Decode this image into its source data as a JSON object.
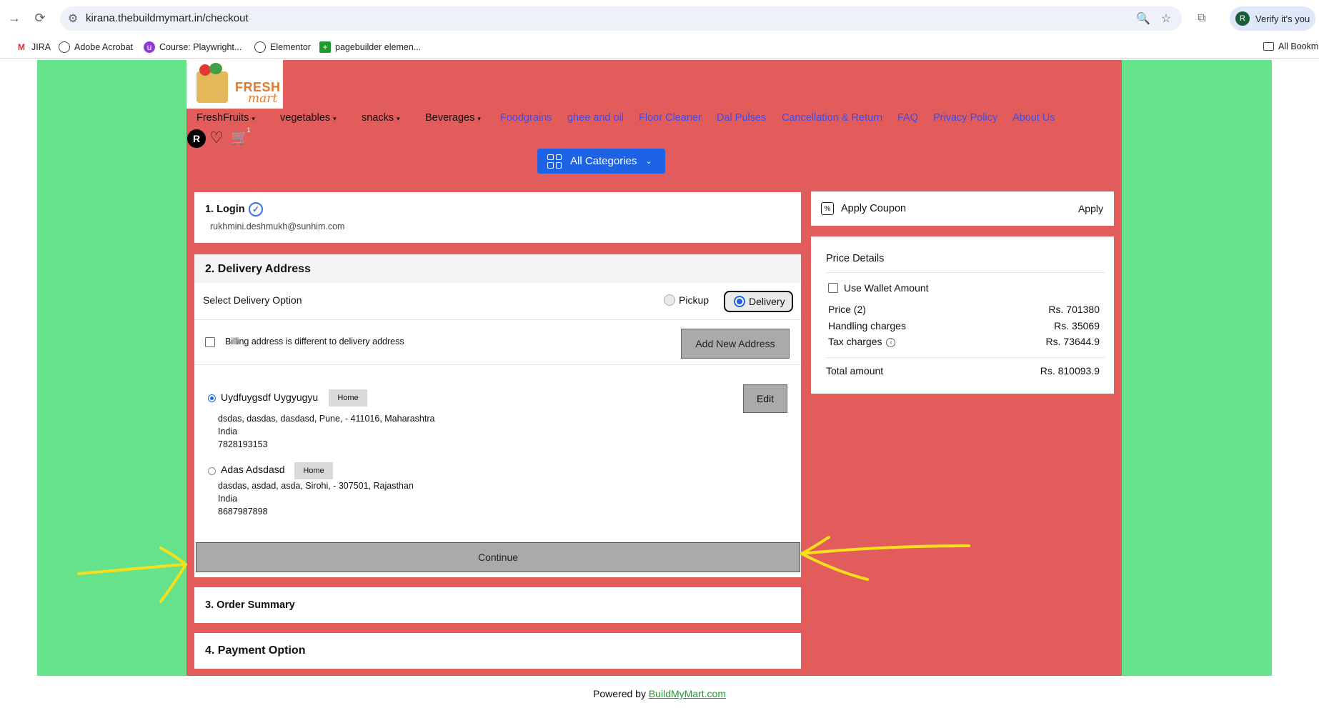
{
  "browser": {
    "url": "kirana.thebuildmymart.in/checkout",
    "verify_label": "Verify it's you",
    "verify_avatar": "R",
    "bookmarks": [
      "JIRA",
      "Adobe Acrobat",
      "Course: Playwright...",
      "Elementor",
      "pagebuilder elemen..."
    ],
    "all_bookmarks": "All Bookm"
  },
  "logo": {
    "fresh": "FRESH",
    "mart": "mart"
  },
  "menu": {
    "dropdowns": [
      "FreshFruits",
      "vegetables",
      "snacks",
      "Beverages"
    ],
    "links": [
      "Foodgrains",
      "ghee and oil",
      "Floor Cleaner",
      "Dal Pulses",
      "Cancellation & Return",
      "FAQ",
      "Privacy Policy",
      "About Us"
    ]
  },
  "user": {
    "initial": "R",
    "cart_count": "1"
  },
  "all_categories": "All Categories",
  "login": {
    "title": "1. Login",
    "email": "rukhmini.deshmukh@sunhim.com"
  },
  "delivery": {
    "title": "2. Delivery Address",
    "select_label": "Select Delivery Option",
    "pickup": "Pickup",
    "delivery": "Delivery",
    "billing_label": "Billing address is different to delivery address",
    "add_new": "Add New Address",
    "edit": "Edit",
    "continue": "Continue",
    "addresses": [
      {
        "name": "Uydfuygsdf Uygyugyu",
        "tag": "Home",
        "line1": "dsdas, dasdas, dasdasd, Pune, - 411016, Maharashtra",
        "country": "India",
        "phone": "7828193153",
        "selected": true
      },
      {
        "name": "Adas Adsdasd",
        "tag": "Home",
        "line1": "dasdas, asdad, asda, Sirohi, - 307501, Rajasthan",
        "country": "India",
        "phone": "8687987898",
        "selected": false
      }
    ]
  },
  "order_summary": {
    "title": "3. Order Summary"
  },
  "payment": {
    "title": "4. Payment Option"
  },
  "coupon": {
    "label": "Apply Coupon",
    "apply": "Apply"
  },
  "price": {
    "title": "Price Details",
    "wallet": "Use Wallet Amount",
    "rows": [
      {
        "label": "Price (2)",
        "value": "Rs. 701380"
      },
      {
        "label": "Handling charges",
        "value": "Rs. 35069"
      },
      {
        "label": "Tax charges",
        "value": "Rs. 73644.9"
      }
    ],
    "total_label": "Total amount",
    "total_value": "Rs. 810093.9"
  },
  "footer": {
    "prefix": "Powered by",
    "link": "BuildMyMart.com"
  },
  "colors": {
    "page_green": "#66e28a",
    "page_red": "#e25c5c",
    "accent_blue": "#1e63e6",
    "annotation_yellow": "#f7e01a"
  }
}
